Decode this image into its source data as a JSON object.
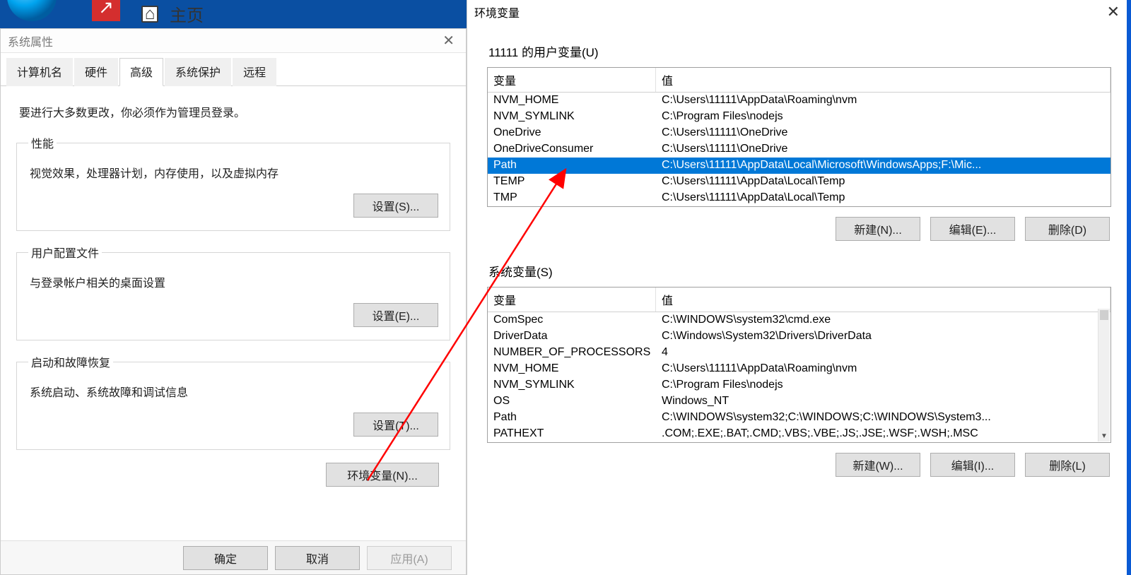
{
  "desktop": {
    "home_label": "主页"
  },
  "sysprop": {
    "title": "系统属性",
    "tabs": {
      "computer_name": "计算机名",
      "hardware": "硬件",
      "advanced": "高级",
      "system_protection": "系统保护",
      "remote": "远程"
    },
    "admin_note": "要进行大多数更改，你必须作为管理员登录。",
    "perf": {
      "legend": "性能",
      "desc": "视觉效果，处理器计划，内存使用，以及虚拟内存",
      "btn": "设置(S)..."
    },
    "profiles": {
      "legend": "用户配置文件",
      "desc": "与登录帐户相关的桌面设置",
      "btn": "设置(E)..."
    },
    "startup": {
      "legend": "启动和故障恢复",
      "desc": "系统启动、系统故障和调试信息",
      "btn": "设置(T)..."
    },
    "env_btn": "环境变量(N)...",
    "footer": {
      "ok": "确定",
      "cancel": "取消",
      "apply": "应用(A)"
    }
  },
  "env": {
    "title": "环境变量",
    "user_section": "11111 的用户变量(U)",
    "sys_section": "系统变量(S)",
    "cols": {
      "var": "变量",
      "val": "值"
    },
    "user_rows": [
      {
        "var": "NVM_HOME",
        "val": "C:\\Users\\11111\\AppData\\Roaming\\nvm"
      },
      {
        "var": "NVM_SYMLINK",
        "val": "C:\\Program Files\\nodejs"
      },
      {
        "var": "OneDrive",
        "val": "C:\\Users\\11111\\OneDrive"
      },
      {
        "var": "OneDriveConsumer",
        "val": "C:\\Users\\11111\\OneDrive"
      },
      {
        "var": "Path",
        "val": "C:\\Users\\11111\\AppData\\Local\\Microsoft\\WindowsApps;F:\\Mic...",
        "selected": true
      },
      {
        "var": "TEMP",
        "val": "C:\\Users\\11111\\AppData\\Local\\Temp"
      },
      {
        "var": "TMP",
        "val": "C:\\Users\\11111\\AppData\\Local\\Temp"
      }
    ],
    "sys_rows": [
      {
        "var": "ComSpec",
        "val": "C:\\WINDOWS\\system32\\cmd.exe"
      },
      {
        "var": "DriverData",
        "val": "C:\\Windows\\System32\\Drivers\\DriverData"
      },
      {
        "var": "NUMBER_OF_PROCESSORS",
        "val": "4"
      },
      {
        "var": "NVM_HOME",
        "val": "C:\\Users\\11111\\AppData\\Roaming\\nvm"
      },
      {
        "var": "NVM_SYMLINK",
        "val": "C:\\Program Files\\nodejs"
      },
      {
        "var": "OS",
        "val": "Windows_NT"
      },
      {
        "var": "Path",
        "val": "C:\\WINDOWS\\system32;C:\\WINDOWS;C:\\WINDOWS\\System3..."
      },
      {
        "var": "PATHEXT",
        "val": ".COM;.EXE;.BAT;.CMD;.VBS;.VBE;.JS;.JSE;.WSF;.WSH;.MSC"
      }
    ],
    "user_btns": {
      "new": "新建(N)...",
      "edit": "编辑(E)...",
      "del": "删除(D)"
    },
    "sys_btns": {
      "new": "新建(W)...",
      "edit": "编辑(I)...",
      "del": "删除(L)"
    }
  }
}
